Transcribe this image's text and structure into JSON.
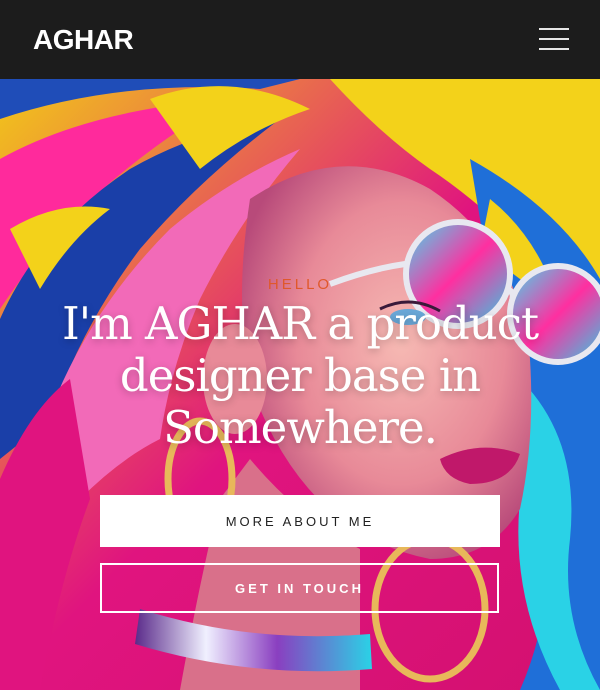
{
  "header": {
    "logo": "AGHAR",
    "menu_icon": "hamburger-menu-icon"
  },
  "hero": {
    "eyebrow": "HELLO",
    "headline_line1": "I'm AGHAR a product",
    "headline_line2": "designer base in",
    "headline_line3": "Somewhere.",
    "primary_button": "MORE ABOUT ME",
    "secondary_button": "GET IN TOUCH"
  },
  "colors": {
    "header_bg": "#1c1c1c",
    "accent": "#e0582b",
    "magenta": "#e0147f",
    "yellow": "#f3d21a",
    "cyan": "#2ad2e6",
    "blue": "#1f4db8"
  }
}
